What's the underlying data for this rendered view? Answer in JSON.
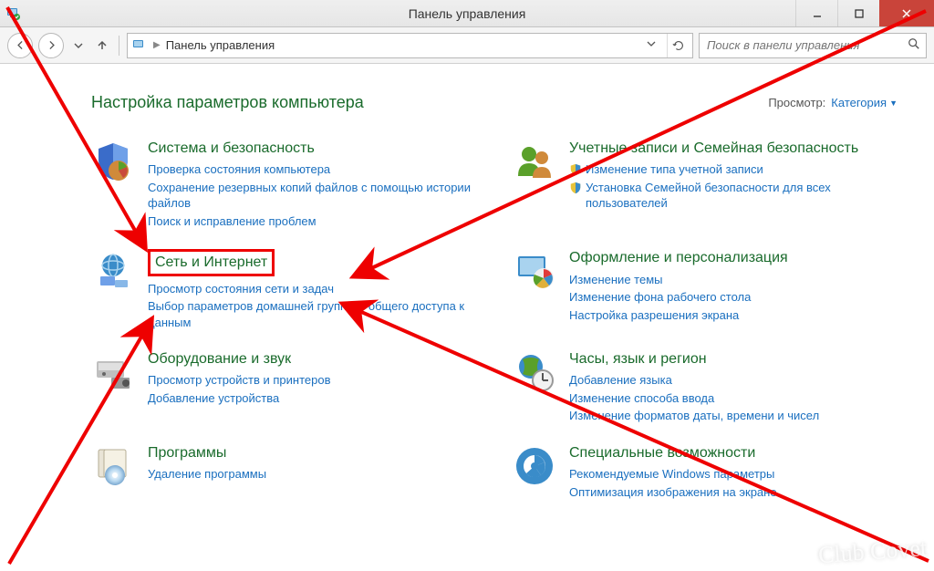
{
  "window": {
    "title": "Панель управления"
  },
  "toolbar": {
    "breadcrumb": "Панель управления",
    "search_placeholder": "Поиск в панели управления"
  },
  "header": {
    "page_title": "Настройка параметров компьютера",
    "view_label": "Просмотр:",
    "view_value": "Категория"
  },
  "categories": [
    {
      "title": "Система и безопасность",
      "links": [
        "Проверка состояния компьютера",
        "Сохранение резервных копий файлов с помощью истории файлов",
        "Поиск и исправление проблем"
      ]
    },
    {
      "title": "Учетные записи и Семейная безопасность",
      "links_shielded": [
        "Изменение типа учетной записи",
        "Установка Семейной безопасности для всех пользователей"
      ]
    },
    {
      "title": "Сеть и Интернет",
      "highlighted": true,
      "links": [
        "Просмотр состояния сети и задач",
        "Выбор параметров домашней группы и общего доступа к данным"
      ]
    },
    {
      "title": "Оформление и персонализация",
      "links": [
        "Изменение темы",
        "Изменение фона рабочего стола",
        "Настройка разрешения экрана"
      ]
    },
    {
      "title": "Оборудование и звук",
      "links": [
        "Просмотр устройств и принтеров",
        "Добавление устройства"
      ]
    },
    {
      "title": "Часы, язык и регион",
      "links": [
        "Добавление языка",
        "Изменение способа ввода",
        "Изменение форматов даты, времени и чисел"
      ]
    },
    {
      "title": "Программы",
      "links": [
        "Удаление программы"
      ]
    },
    {
      "title": "Специальные возможности",
      "links": [
        "Рекомендуемые Windows параметры",
        "Оптимизация изображения на экране"
      ]
    }
  ],
  "watermark": "Сlub Сovet"
}
